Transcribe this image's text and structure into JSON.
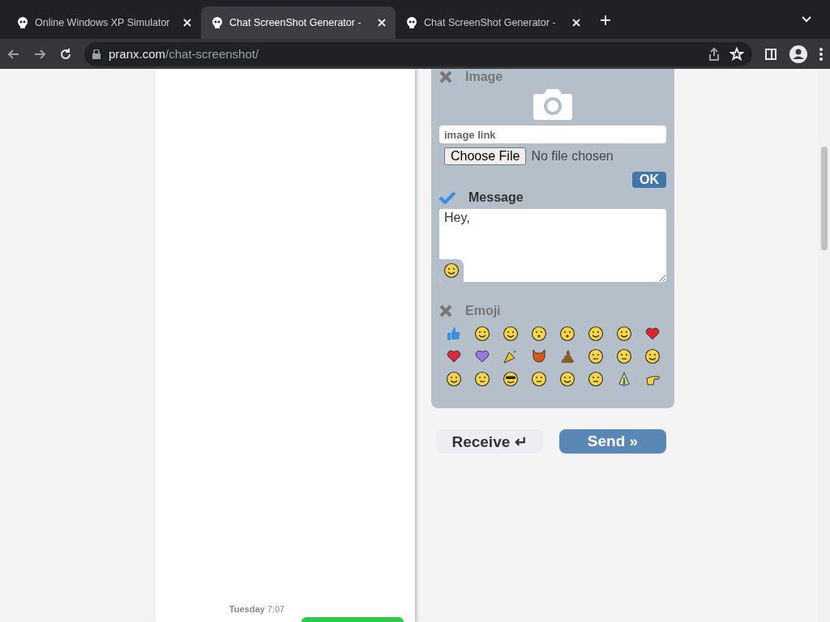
{
  "browser": {
    "tabs": [
      {
        "title": "Online Windows XP Simulator",
        "selected": false
      },
      {
        "title": "Chat ScreenShot Generator -",
        "selected": true
      },
      {
        "title": "Chat ScreenShot Generator -",
        "selected": false
      }
    ],
    "address": {
      "host": "pranx.com",
      "path": "/chat-screenshot/"
    }
  },
  "preview": {
    "timestamp": "**Tuesday** 7:07"
  },
  "editor": {
    "image": {
      "label": "Image",
      "enabled": false,
      "link_placeholder": "image link",
      "file_button": "Choose File",
      "file_status": "No file chosen",
      "ok": "OK"
    },
    "message": {
      "label": "Message",
      "enabled": true,
      "value": "Hey, "
    },
    "emoji": {
      "label": "Emoji",
      "enabled": false
    }
  },
  "actions": {
    "receive": "Receive ↵",
    "send": "Send »"
  }
}
